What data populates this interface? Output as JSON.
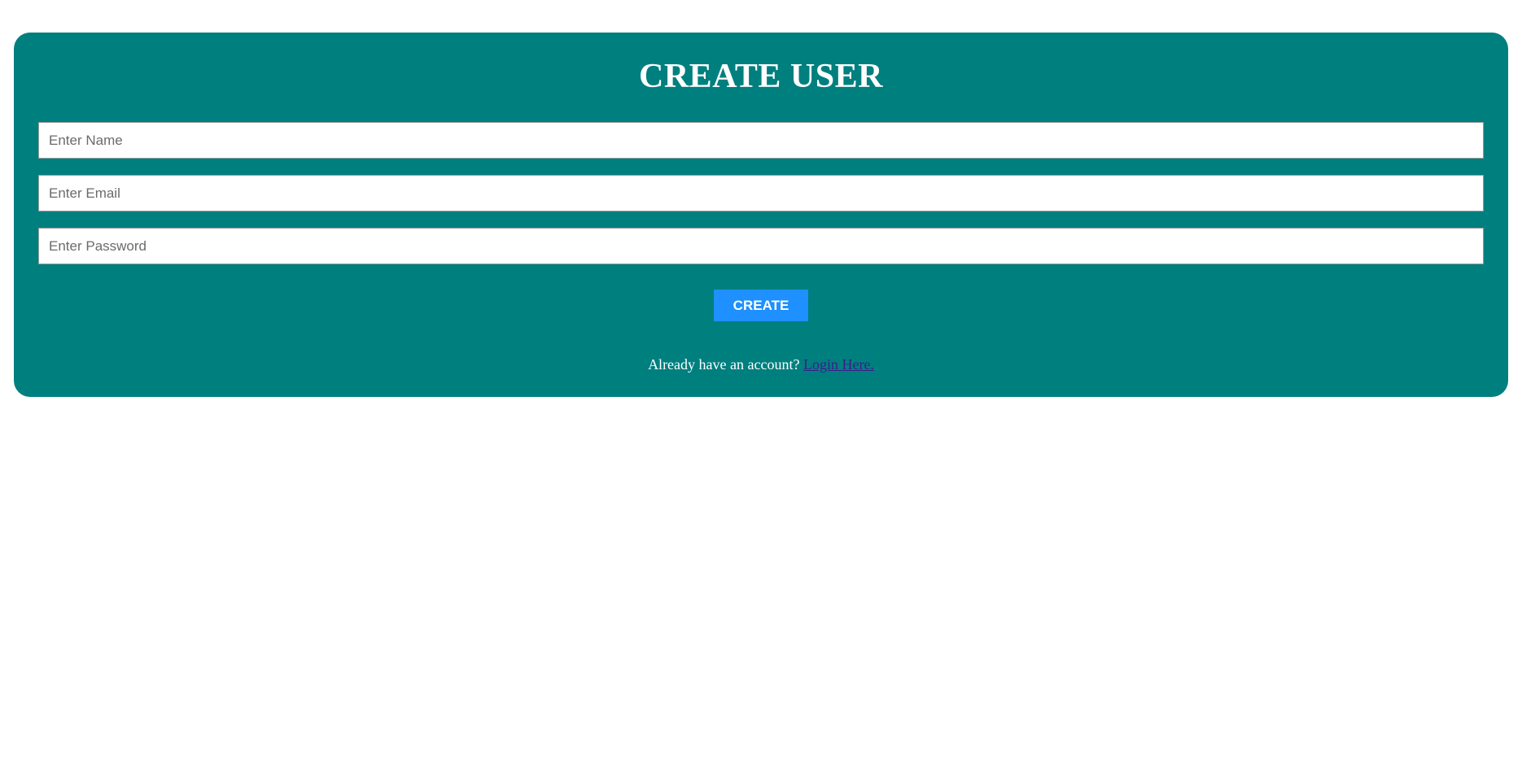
{
  "form": {
    "title": "CREATE USER",
    "name_placeholder": "Enter Name",
    "email_placeholder": "Enter Email",
    "password_placeholder": "Enter Password",
    "name_value": "",
    "email_value": "",
    "password_value": "",
    "submit_label": "CREATE",
    "footer_text": "Already have an account?",
    "login_link_text": "Login Here."
  },
  "colors": {
    "card_background": "#007f7f",
    "button_background": "#1e90ff",
    "link": "#3a1d8a",
    "text": "#ffffff"
  }
}
